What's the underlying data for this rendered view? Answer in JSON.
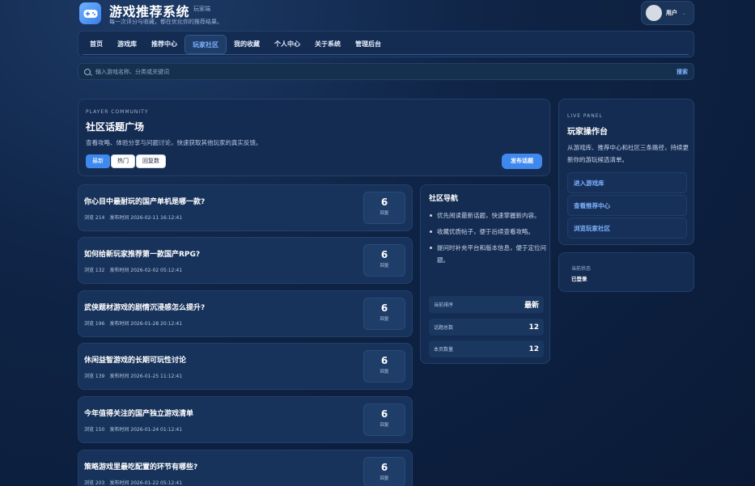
{
  "header": {
    "app_title": "游戏推荐系统",
    "badge": "玩家端",
    "subtitle": "每一次评分与收藏，都在优化你的推荐结果。",
    "user_name": "用户"
  },
  "nav": {
    "items": [
      {
        "label": "首页",
        "active": false
      },
      {
        "label": "游戏库",
        "active": false
      },
      {
        "label": "推荐中心",
        "active": false
      },
      {
        "label": "玩家社区",
        "active": true
      },
      {
        "label": "我的收藏",
        "active": false
      },
      {
        "label": "个人中心",
        "active": false
      },
      {
        "label": "关于系统",
        "active": false
      },
      {
        "label": "管理后台",
        "active": false
      }
    ]
  },
  "search": {
    "placeholder": "输入游戏名称、分类或关键词",
    "button": "搜索"
  },
  "community": {
    "kicker": "PLAYER COMMUNITY",
    "title": "社区话题广场",
    "description": "查看攻略、体验分享与问题讨论，快速获取其他玩家的真实反馈。",
    "sort_options": [
      "最新",
      "热门",
      "回复数"
    ],
    "post_button": "发布话题"
  },
  "topics": [
    {
      "title": "你心目中最耐玩的国产单机是哪一款?",
      "views": "浏览 214",
      "time": "发布时间 2026-02-11 16:12:41",
      "replies": "6",
      "reply_label": "回复"
    },
    {
      "title": "如何给新玩家推荐第一款国产RPG?",
      "views": "浏览 132",
      "time": "发布时间 2026-02-02 05:12:41",
      "replies": "6",
      "reply_label": "回复"
    },
    {
      "title": "武侠题材游戏的剧情沉浸感怎么提升?",
      "views": "浏览 196",
      "time": "发布时间 2026-01-28 20:12:41",
      "replies": "6",
      "reply_label": "回复"
    },
    {
      "title": "休闲益智游戏的长期可玩性讨论",
      "views": "浏览 139",
      "time": "发布时间 2026-01-25 11:12:41",
      "replies": "6",
      "reply_label": "回复"
    },
    {
      "title": "今年值得关注的国产独立游戏清单",
      "views": "浏览 150",
      "time": "发布时间 2026-01-24 01:12:41",
      "replies": "6",
      "reply_label": "回复"
    },
    {
      "title": "策略游戏里最吃配置的环节有哪些?",
      "views": "浏览 203",
      "time": "发布时间 2026-01-22 05:12:41",
      "replies": "6",
      "reply_label": "回复"
    }
  ],
  "guide": {
    "title": "社区导航",
    "tips": [
      "优先阅读最新话题，快速掌握新内容。",
      "收藏优质帖子，便于后续查看攻略。",
      "提问时补充平台和版本信息，便于定位问题。"
    ],
    "stats": [
      {
        "label": "当前排序",
        "value": "最新"
      },
      {
        "label": "话题总数",
        "value": "12"
      },
      {
        "label": "本页数量",
        "value": "12"
      }
    ]
  },
  "live_panel": {
    "kicker": "LIVE PANEL",
    "title": "玩家操作台",
    "description": "从游戏库、推荐中心和社区三条路径，持续更新你的游玩候选清单。",
    "links": [
      "进入游戏库",
      "查看推荐中心",
      "浏览玩家社区"
    ]
  },
  "status": {
    "label": "当前状态",
    "value": "已登录"
  }
}
